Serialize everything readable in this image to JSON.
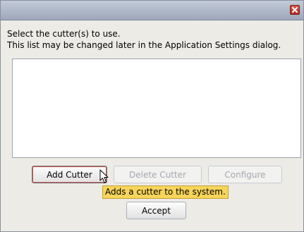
{
  "dialog": {
    "message_line1": "Select the cutter(s) to use.",
    "message_line2": "This list may be changed later in the Application Settings dialog.",
    "cutter_list": {
      "items": []
    }
  },
  "buttons": {
    "add_cutter": "Add Cutter",
    "delete_cutter": "Delete Cutter",
    "configure": "Configure",
    "accept": "Accept"
  },
  "tooltip": {
    "text": "Adds a cutter to the system."
  },
  "icons": {
    "close": "close-icon",
    "cursor": "mouse-pointer-icon"
  },
  "colors": {
    "titlebar": "#aeb7c8",
    "close": "#c63a2f",
    "tooltip": "#f7d45a",
    "focus": "#c85c4a"
  }
}
